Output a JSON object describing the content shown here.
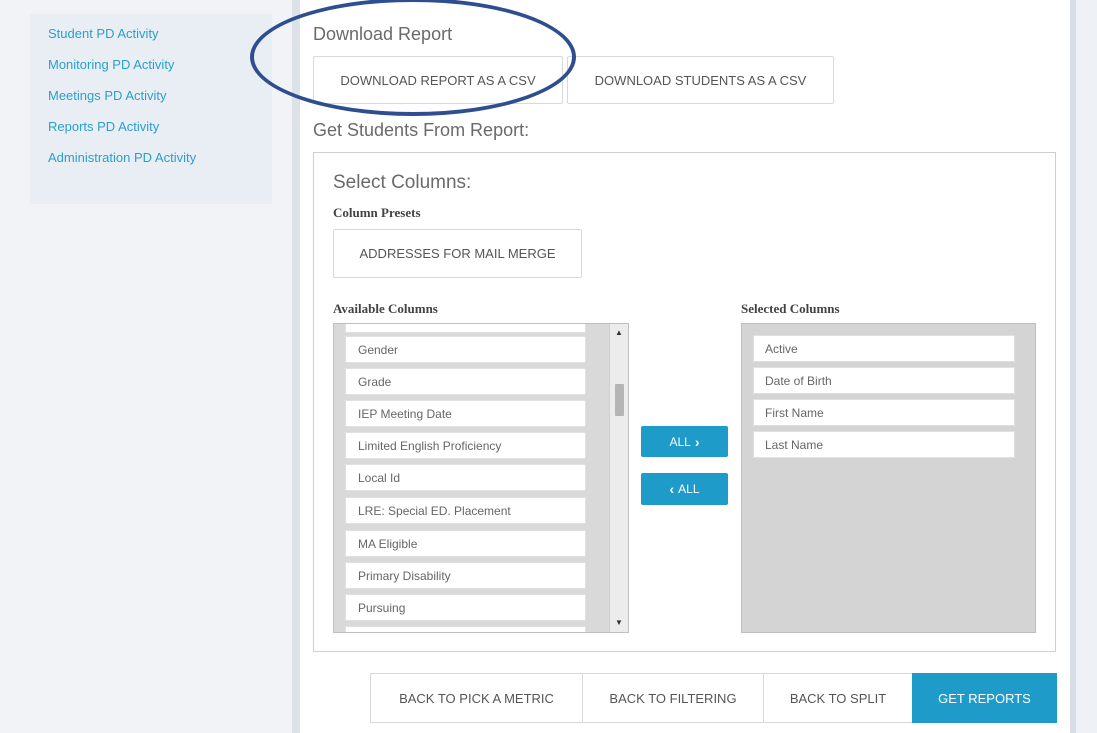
{
  "sidebar": {
    "items": [
      {
        "label": "Student PD Activity"
      },
      {
        "label": "Monitoring PD Activity"
      },
      {
        "label": "Meetings PD Activity"
      },
      {
        "label": "Reports PD Activity"
      },
      {
        "label": "Administration PD Activity"
      }
    ]
  },
  "download": {
    "title": "Download Report",
    "report_csv_label": "Download Report as a CSV",
    "students_csv_label": "Download Students as a CSV"
  },
  "get_students": {
    "title": "Get Students From Report:",
    "select_columns_title": "Select Columns:",
    "column_presets_label": "Column Presets",
    "preset_button_label": "Addresses for Mail Merge",
    "available_label": "Available Columns",
    "selected_label": "Selected Columns",
    "available_columns": [
      "Gender",
      "Grade",
      "IEP Meeting Date",
      "Limited English Proficiency",
      "Local Id",
      "LRE: Special ED. Placement",
      "MA Eligible",
      "Primary Disability",
      "Pursuing"
    ],
    "selected_columns": [
      "Active",
      "Date of Birth",
      "First Name",
      "Last Name"
    ],
    "move_all_right_label": "ALL",
    "move_all_left_label": "ALL"
  },
  "footer": {
    "back_metric": "Back to Pick a Metric",
    "back_filtering": "Back to Filtering",
    "back_split": "Back to Split",
    "get_reports": "Get Reports"
  },
  "colors": {
    "accent": "#1f9bc9",
    "link": "#2aa0c9",
    "annotation": "#2f4e8f"
  }
}
